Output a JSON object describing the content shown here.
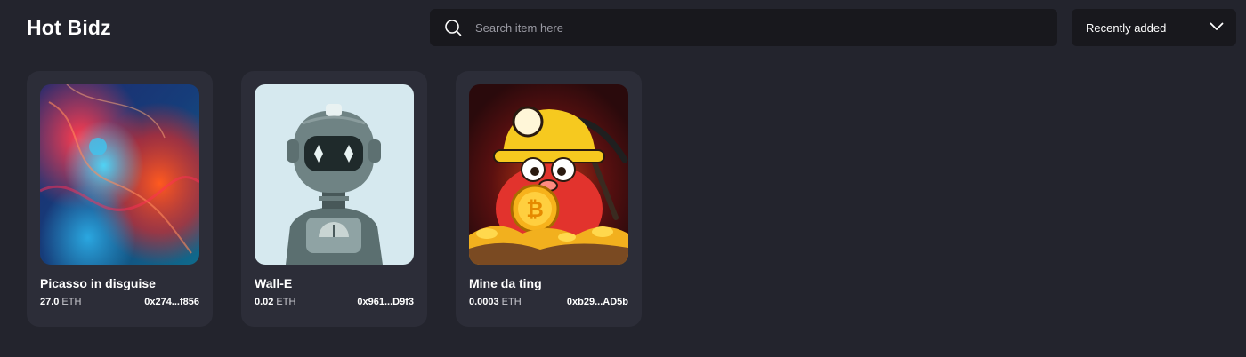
{
  "header": {
    "title": "Hot Bidz"
  },
  "search": {
    "placeholder": "Search item here",
    "icon": "search-icon"
  },
  "sort": {
    "selected": "Recently added",
    "icon": "chevron-down-icon"
  },
  "items": [
    {
      "name": "Picasso in disguise",
      "price": "27.0",
      "currency": "ETH",
      "address": "0x274...f856",
      "image": "abstract-ink-art"
    },
    {
      "name": "Wall-E",
      "price": "0.02",
      "currency": "ETH",
      "address": "0x961...D9f3",
      "image": "robot-portrait"
    },
    {
      "name": "Mine da ting",
      "price": "0.0003",
      "currency": "ETH",
      "address": "0xb29...AD5b",
      "image": "miner-mole-bitcoin"
    }
  ],
  "colors": {
    "background": "#23242d",
    "card": "#2c2d38",
    "input": "#18181d",
    "text": "#ffffff",
    "muted": "#9a9aa3"
  }
}
